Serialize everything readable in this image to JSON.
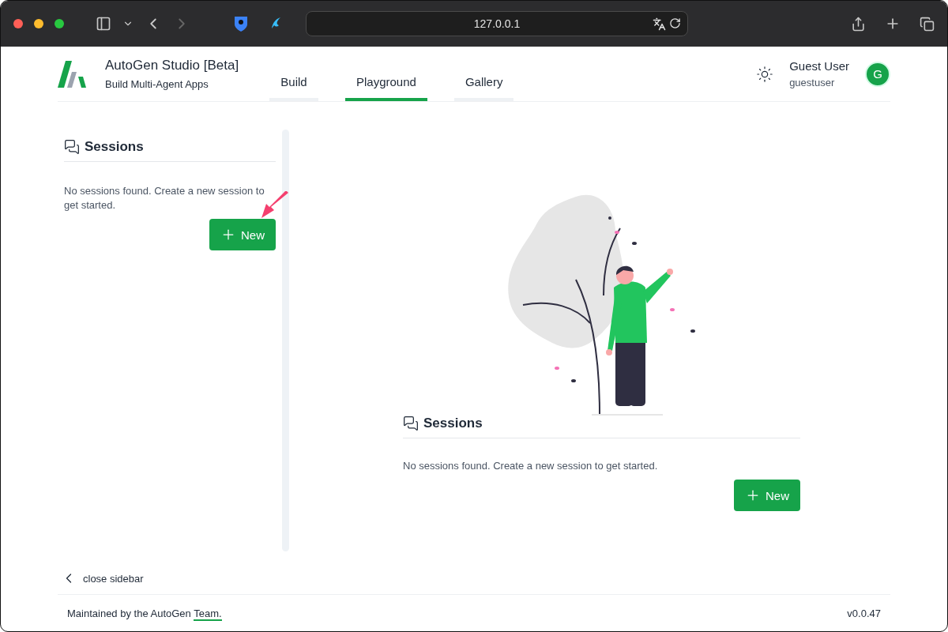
{
  "browser": {
    "url": "127.0.0.1"
  },
  "app": {
    "title": "AutoGen Studio [Beta]",
    "subtitle": "Build Multi-Agent Apps"
  },
  "tabs": [
    {
      "label": "Build",
      "selected": false
    },
    {
      "label": "Playground",
      "selected": true
    },
    {
      "label": "Gallery",
      "selected": false
    }
  ],
  "user": {
    "name": "Guest User",
    "username": "guestuser",
    "avatar": "G"
  },
  "sidebar": {
    "title": "Sessions",
    "message": "No sessions found. Create a new session to get started.",
    "button": "New",
    "toggle": "close sidebar"
  },
  "main": {
    "title": "Sessions",
    "message": "No sessions found. Create a new session to get started.",
    "button": "New"
  },
  "footer": {
    "text": "Maintained by the AutoGen ",
    "link": "Team.",
    "version": "v0.0.47"
  }
}
